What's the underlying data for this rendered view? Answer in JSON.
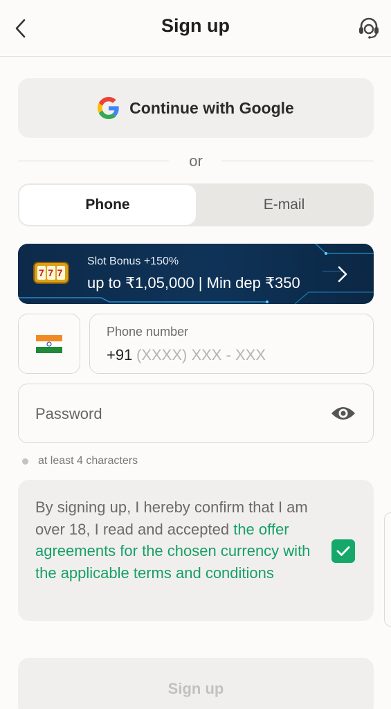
{
  "header": {
    "title": "Sign up"
  },
  "google": {
    "label": "Continue with Google"
  },
  "divider": {
    "text": "or"
  },
  "tabs": [
    {
      "label": "Phone",
      "active": true
    },
    {
      "label": "E-mail",
      "active": false
    }
  ],
  "bonus": {
    "line1": "Slot Bonus +150%",
    "line2": "up to ₹1,05,000 | Min dep ₹350",
    "slot_digits": "777"
  },
  "phone": {
    "label": "Phone number",
    "country_code": "+91",
    "placeholder": "(XXXX) XXX - XXX"
  },
  "password": {
    "placeholder": "Password"
  },
  "hint": {
    "text": "at least 4 characters"
  },
  "terms": {
    "text": "By signing up, I hereby confirm that I am over 18, I read and accepted ",
    "link": "the offer agreements for the chosen currency with the applicable terms and conditions",
    "checked": true
  },
  "signup": {
    "label": "Sign up",
    "enabled": false
  },
  "colors": {
    "accent_green": "#15a86a",
    "link_green": "#16a068",
    "banner_blue": "#0f3358"
  },
  "icons": [
    "chevron-left-icon",
    "headset-icon",
    "google-icon",
    "slot-machine-icon",
    "chevron-right-icon",
    "india-flag-icon",
    "eye-icon",
    "checkmark-icon"
  ]
}
